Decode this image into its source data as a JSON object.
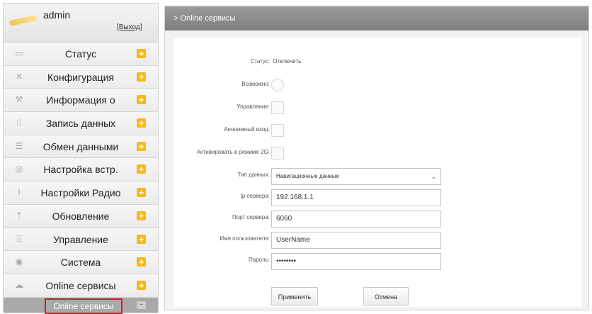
{
  "user": {
    "name": "admin",
    "subtitle": "",
    "logout": "[Выход]"
  },
  "sidebar": {
    "items": [
      {
        "label": "Статус",
        "icon": "monitor-icon"
      },
      {
        "label": "Конфигурация",
        "icon": "tools-icon"
      },
      {
        "label": "Информация о",
        "icon": "info-icon"
      },
      {
        "label": "Запись данных",
        "icon": "record-icon"
      },
      {
        "label": "Обмен данными",
        "icon": "exchange-icon"
      },
      {
        "label": "Настройка встр.",
        "icon": "settings-icon"
      },
      {
        "label": "Настройки Радио",
        "icon": "radio-icon"
      },
      {
        "label": "Обновление",
        "icon": "upload-icon"
      },
      {
        "label": "Управление",
        "icon": "manage-icon"
      },
      {
        "label": "Система",
        "icon": "system-icon"
      },
      {
        "label": "Online сервисы",
        "icon": "cloud-icon"
      }
    ],
    "expand_symbol": "+",
    "collapse_symbol": "−",
    "active_sub": "Online сервисы"
  },
  "header": {
    "breadcrumb": "> Online сервисы"
  },
  "form": {
    "status_label": "Статус:",
    "status_value": "Отключить",
    "enable_label": "Возможно:",
    "manage_label": "Управление:",
    "anon_label": "Анонимный вход:",
    "activate2g_label": "Активировать в режиме 2G:",
    "data_type_label": "Тип данных:",
    "data_type_value": "Навигационные данные",
    "ip_label": "Ip сервера:",
    "ip_value": "192.168.1.1",
    "port_label": "Порт сервера:",
    "port_value": "6060",
    "username_label": "Имя пользователя:",
    "username_value": "UserName",
    "password_label": "Пароль:",
    "password_value": "••••••••",
    "apply_button": "Применить",
    "cancel_button": "Отмена"
  },
  "colors": {
    "accent": "#f5b81e",
    "highlight_border": "#d4202a",
    "header_bg": "#8a8a8a"
  }
}
